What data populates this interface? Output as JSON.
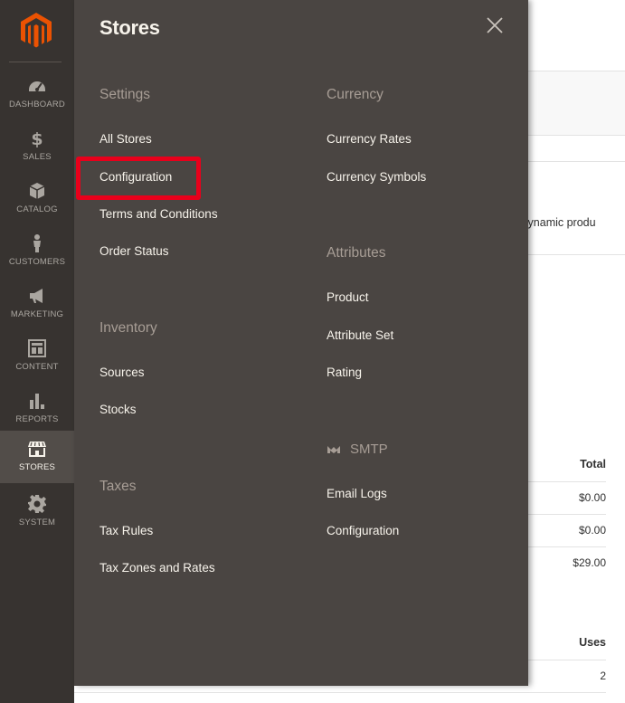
{
  "sidebar": {
    "items": [
      {
        "label": "DASHBOARD",
        "icon": "dashboard-icon"
      },
      {
        "label": "SALES",
        "icon": "dollar-icon"
      },
      {
        "label": "CATALOG",
        "icon": "box-icon"
      },
      {
        "label": "CUSTOMERS",
        "icon": "person-icon"
      },
      {
        "label": "MARKETING",
        "icon": "megaphone-icon"
      },
      {
        "label": "CONTENT",
        "icon": "layout-icon"
      },
      {
        "label": "REPORTS",
        "icon": "bar-chart-icon"
      },
      {
        "label": "STORES",
        "icon": "storefront-icon"
      },
      {
        "label": "SYSTEM",
        "icon": "gear-icon"
      }
    ],
    "active_label": "STORES"
  },
  "flyout": {
    "title": "Stores",
    "settings": {
      "title": "Settings",
      "links": [
        "All Stores",
        "Configuration",
        "Terms and Conditions",
        "Order Status"
      ]
    },
    "inventory": {
      "title": "Inventory",
      "links": [
        "Sources",
        "Stocks"
      ]
    },
    "taxes": {
      "title": "Taxes",
      "links": [
        "Tax Rules",
        "Tax Zones and Rates"
      ]
    },
    "currency": {
      "title": "Currency",
      "links": [
        "Currency Rates",
        "Currency Symbols"
      ]
    },
    "attributes": {
      "title": "Attributes",
      "links": [
        "Product",
        "Attribute Set",
        "Rating"
      ]
    },
    "smtp": {
      "title": "SMTP",
      "links": [
        "Email Logs",
        "Configuration"
      ]
    }
  },
  "background": {
    "snippet": "ur dynamic produ",
    "totals_header": "Total",
    "totals": [
      "$0.00",
      "$0.00",
      "$29.00"
    ],
    "uses_header": "Uses",
    "uses": [
      "2"
    ]
  },
  "colors": {
    "sidebar_bg": "#373330",
    "flyout_bg": "#4a4542",
    "highlight": "#e8001b",
    "logo": "#eb5202"
  }
}
